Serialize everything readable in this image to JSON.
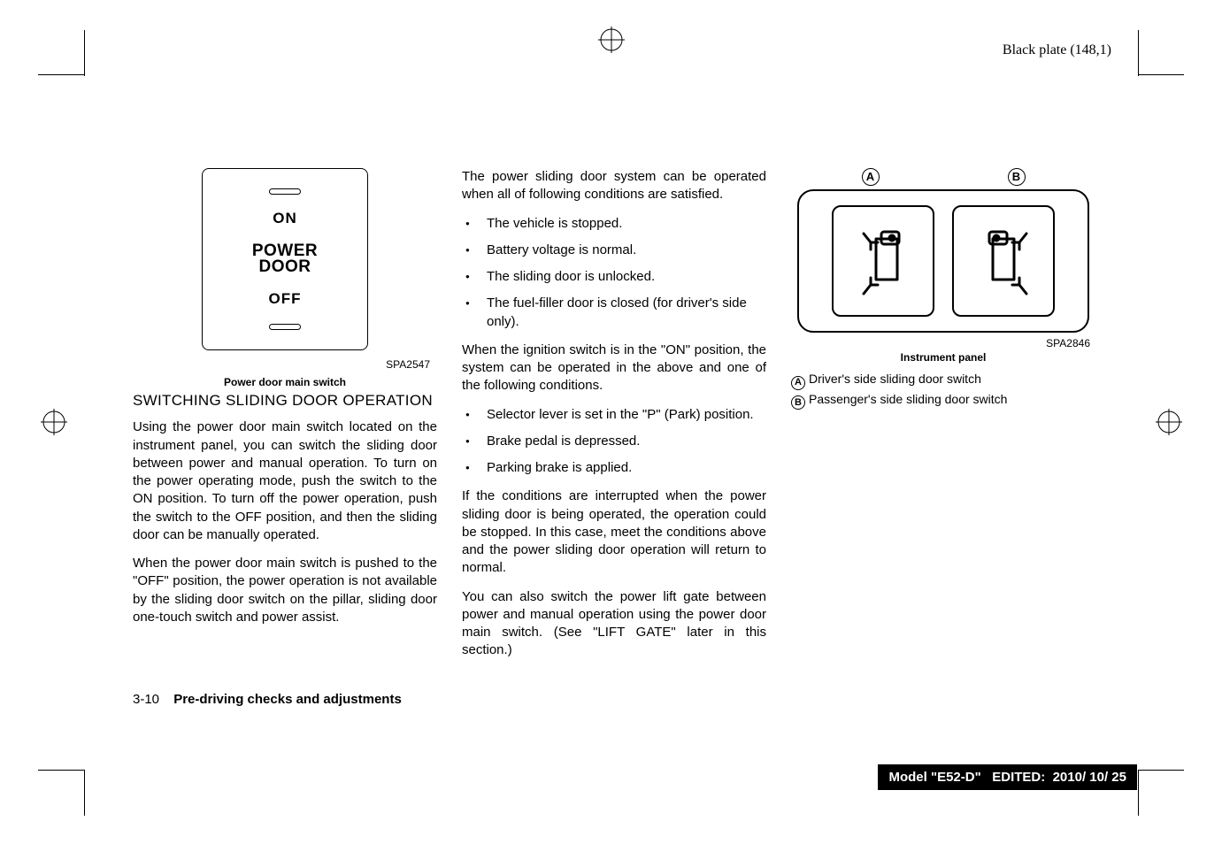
{
  "header": "Black plate (148,1)",
  "figure1": {
    "on": "ON",
    "brand_line1": "POWER",
    "brand_line2": "DOOR",
    "off": "OFF",
    "code": "SPA2547",
    "caption": "Power door main switch"
  },
  "col1": {
    "heading": "SWITCHING SLIDING DOOR OPERATION",
    "p1": "Using the power door main switch located on the instrument panel, you can switch the sliding door between power and manual operation. To turn on the power operating mode, push the switch to the ON position. To turn off the power operation, push the switch to the OFF position, and then the sliding door can be manually operated.",
    "p2": "When the power door main switch is pushed to the \"OFF\" position, the power operation is not available by the sliding door switch on the pillar, sliding door one-touch switch and power assist."
  },
  "col2": {
    "intro": "The power sliding door system can be operated when all of following conditions are satisfied.",
    "listA": [
      "The vehicle is stopped.",
      "Battery voltage is normal.",
      "The sliding door is unlocked.",
      "The fuel-filler door is closed (for driver's side only)."
    ],
    "mid": "When the ignition switch is in the \"ON\" position, the system can be operated in the above and one of the following conditions.",
    "listB": [
      "Selector lever is set in the \"P\" (Park) position.",
      "Brake pedal is depressed.",
      "Parking brake is applied."
    ],
    "p3": "If the conditions are interrupted when the power sliding door is being operated, the operation could be stopped. In this case, meet the conditions above and the power sliding door operation will return to normal.",
    "p4": "You can also switch the power lift gate between power and manual operation using the power door main switch. (See \"LIFT GATE\" later in this section.)"
  },
  "figure2": {
    "letterA": "A",
    "letterB": "B",
    "code": "SPA2846",
    "caption": "Instrument panel",
    "legendA": "Driver's side sliding door switch",
    "legendB": "Passenger's side sliding door switch"
  },
  "footer": {
    "page": "3-10",
    "title": "Pre-driving checks and adjustments"
  },
  "blackbar": {
    "model_label": "Model",
    "model_val": "\"E52-D\"",
    "edited_label": "EDITED:",
    "edited_val": "2010/ 10/ 25"
  }
}
